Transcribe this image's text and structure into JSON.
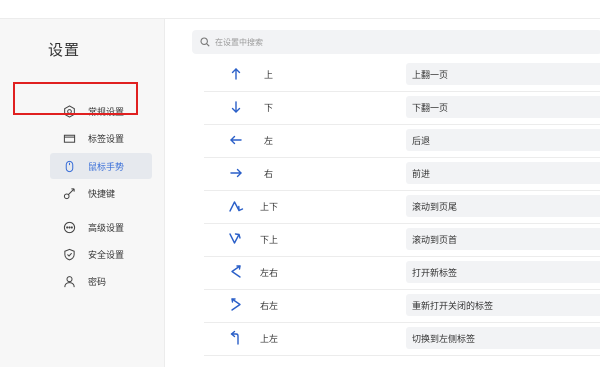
{
  "page": {
    "title": "设置"
  },
  "search": {
    "placeholder": "在设置中搜索",
    "value": ""
  },
  "sidebar": {
    "items": [
      {
        "label": "常规设置",
        "icon": "gear-icon",
        "active": false
      },
      {
        "label": "标签设置",
        "icon": "tab-icon",
        "active": false
      },
      {
        "label": "鼠标手势",
        "icon": "mouse-icon",
        "active": true
      },
      {
        "label": "快捷键",
        "icon": "shortcut-key-icon",
        "active": false
      },
      {
        "label": "高级设置",
        "icon": "more-icon",
        "active": false
      },
      {
        "label": "安全设置",
        "icon": "shield-icon",
        "active": false
      },
      {
        "label": "密码",
        "icon": "user-icon",
        "active": false
      }
    ]
  },
  "gestures": [
    {
      "name": "上",
      "icon": "arrow-up-icon",
      "action": "上翻一页"
    },
    {
      "name": "下",
      "icon": "arrow-down-icon",
      "action": "下翻一页"
    },
    {
      "name": "左",
      "icon": "arrow-left-icon",
      "action": "后退"
    },
    {
      "name": "右",
      "icon": "arrow-right-icon",
      "action": "前进"
    },
    {
      "name": "上下",
      "icon": "gesture-up-down-icon",
      "action": "滚动到页尾"
    },
    {
      "name": "下上",
      "icon": "gesture-down-up-icon",
      "action": "滚动到页首"
    },
    {
      "name": "左右",
      "icon": "gesture-left-right-icon",
      "action": "打开新标签"
    },
    {
      "name": "右左",
      "icon": "gesture-right-left-icon",
      "action": "重新打开关闭的标签"
    },
    {
      "name": "上左",
      "icon": "gesture-up-left-icon",
      "action": "切换到左侧标签"
    }
  ],
  "colors": {
    "accent": "#3a6fd8",
    "highlight": "#e02020",
    "sidebar_bg": "#f7f7f7",
    "active_bg": "#e6e9ee"
  }
}
